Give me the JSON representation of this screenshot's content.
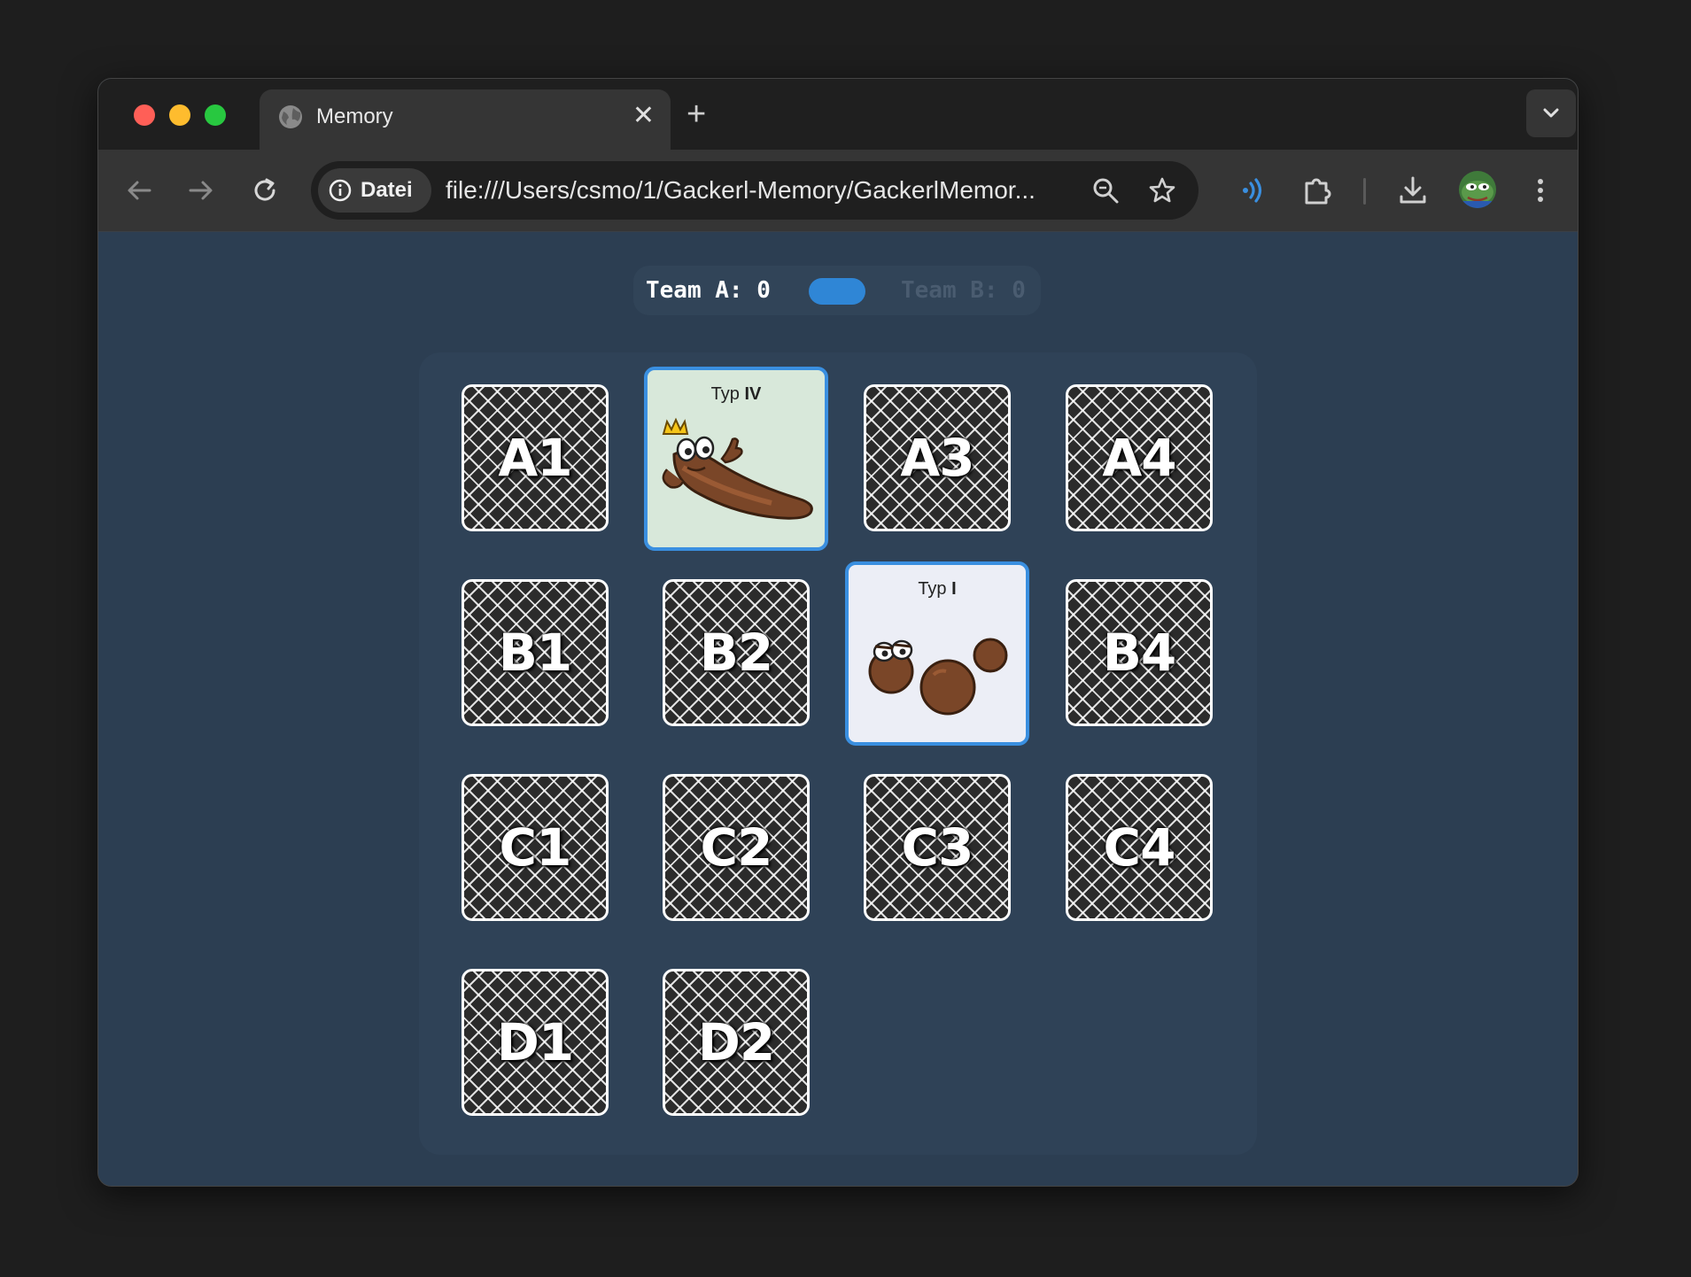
{
  "browser": {
    "tab_title": "Memory",
    "tab_close": "✕",
    "tab_new": "+",
    "site_info_label": "Datei",
    "url": "file:///Users/csmo/1/Gackerl-Memory/GackerlMemor..."
  },
  "scoreboard": {
    "team_a": "Team A: 0",
    "team_b": "Team B: 0",
    "active_team": "A"
  },
  "board": {
    "cards": [
      {
        "id": "A1",
        "label": "A1",
        "face": "down"
      },
      {
        "id": "A2",
        "face": "up",
        "type_prefix": "Typ ",
        "type_value": "IV"
      },
      {
        "id": "A3",
        "label": "A3",
        "face": "down"
      },
      {
        "id": "A4",
        "label": "A4",
        "face": "down"
      },
      {
        "id": "B1",
        "label": "B1",
        "face": "down"
      },
      {
        "id": "B2",
        "label": "B2",
        "face": "down"
      },
      {
        "id": "B3",
        "face": "up",
        "type_prefix": "Typ ",
        "type_value": "I"
      },
      {
        "id": "B4",
        "label": "B4",
        "face": "down"
      },
      {
        "id": "C1",
        "label": "C1",
        "face": "down"
      },
      {
        "id": "C2",
        "label": "C2",
        "face": "down"
      },
      {
        "id": "C3",
        "label": "C3",
        "face": "down"
      },
      {
        "id": "C4",
        "label": "C4",
        "face": "down"
      },
      {
        "id": "D1",
        "label": "D1",
        "face": "down"
      },
      {
        "id": "D2",
        "label": "D2",
        "face": "down"
      }
    ]
  },
  "colors": {
    "accent": "#2f86d6",
    "background": "#2c3e52",
    "card_open_a2": "#d8e8da",
    "card_open_b3": "#eceef6"
  }
}
